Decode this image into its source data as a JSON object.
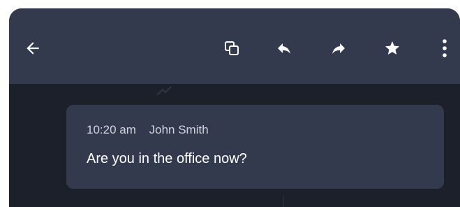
{
  "toolbar": {
    "icons": [
      {
        "name": "back-arrow-icon",
        "label": "Back"
      },
      {
        "name": "copy-icon",
        "label": "Copy"
      },
      {
        "name": "reply-icon",
        "label": "Reply"
      },
      {
        "name": "forward-icon",
        "label": "Forward"
      },
      {
        "name": "star-icon",
        "label": "Star"
      },
      {
        "name": "more-vert-icon",
        "label": "More"
      }
    ]
  },
  "message": {
    "time": "10:20 am",
    "sender": "John Smith",
    "text": "Are you in the office now?"
  },
  "colors": {
    "app_bar": "#343a4e",
    "background": "#1c202b",
    "card": "#343a4e",
    "icon": "#ffffff",
    "meta_text": "#d0d4de",
    "body_text": "#ffffff"
  }
}
